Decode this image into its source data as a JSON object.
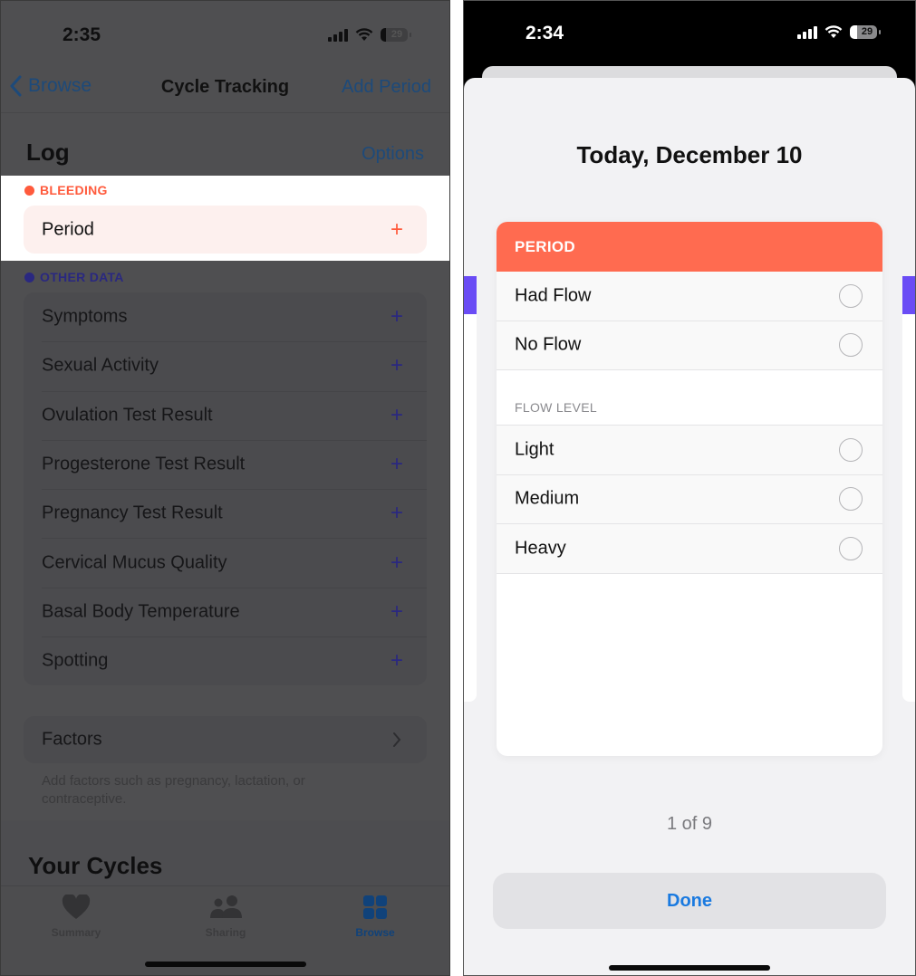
{
  "left": {
    "status_bar": {
      "time": "2:35",
      "battery": "29"
    },
    "nav": {
      "back_label": "Browse",
      "title": "Cycle Tracking",
      "action_label": "Add Period"
    },
    "log": {
      "title": "Log",
      "options_label": "Options"
    },
    "bleeding": {
      "header": "BLEEDING",
      "color": "#ff5a3c",
      "item": {
        "label": "Period",
        "action": "+"
      }
    },
    "other_data": {
      "header": "OTHER DATA",
      "color": "#2a2880",
      "items": [
        {
          "label": "Symptoms",
          "action": "+"
        },
        {
          "label": "Sexual Activity",
          "action": "+"
        },
        {
          "label": "Ovulation Test Result",
          "action": "+"
        },
        {
          "label": "Progesterone Test Result",
          "action": "+"
        },
        {
          "label": "Pregnancy Test Result",
          "action": "+"
        },
        {
          "label": "Cervical Mucus Quality",
          "action": "+"
        },
        {
          "label": "Basal Body Temperature",
          "action": "+"
        },
        {
          "label": "Spotting",
          "action": "+"
        }
      ]
    },
    "factors": {
      "label": "Factors",
      "note": "Add factors such as pregnancy, lactation, or contraceptive."
    },
    "your_cycles_title": "Your Cycles",
    "tabs": [
      {
        "label": "Summary",
        "icon": "heart-icon",
        "active": false
      },
      {
        "label": "Sharing",
        "icon": "people-icon",
        "active": false
      },
      {
        "label": "Browse",
        "icon": "grid-icon",
        "active": true
      }
    ]
  },
  "right": {
    "status_bar": {
      "time": "2:34",
      "battery": "29"
    },
    "date_title": "Today, December 10",
    "card": {
      "header": "PERIOD",
      "header_color": "#ff6b50",
      "options": [
        {
          "label": "Had Flow",
          "selected": false
        },
        {
          "label": "No Flow",
          "selected": false
        }
      ],
      "flow_level_label": "FLOW LEVEL",
      "flow_levels": [
        {
          "label": "Light",
          "selected": false
        },
        {
          "label": "Medium",
          "selected": false
        },
        {
          "label": "Heavy",
          "selected": false
        }
      ]
    },
    "pager": "1 of 9",
    "done_label": "Done"
  }
}
